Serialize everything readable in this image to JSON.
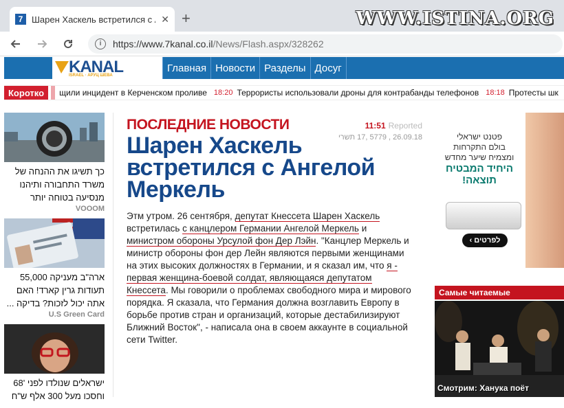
{
  "browser": {
    "tab_icon": "7",
    "tab_title": "Шарен Хаскель встретился с Анге",
    "tab_close": "✕",
    "new_tab": "+",
    "watermark": "WWW.ISTINA.ORG",
    "url_main": "https://www.7kanal.co.il",
    "url_path": "/News/Flash.aspx/328262"
  },
  "site": {
    "logo": "KANAL",
    "logo_sub": "ISRAEL · АРУЦ ШЕВА",
    "menu": [
      "Главная",
      "Новости",
      "Разделы",
      "Досуг"
    ]
  },
  "ticker": {
    "label": "Коротко",
    "items": [
      {
        "time": "",
        "text": "щили инцидент в Керченском проливе"
      },
      {
        "time": "18:20",
        "text": "Террористы использовали дроны для контрабанды телефонов"
      },
      {
        "time": "18:18",
        "text": "Протесты шк"
      }
    ]
  },
  "left": [
    {
      "text": "כך תשיגו את ההנחה של משרד התחבורה ותיהנו מנסיעה בטוחה יותר",
      "source": "VOOOM"
    },
    {
      "text": "ארה\"ב מעניקה 55,000 תעודות גרין קארד! האם אתה יכול לזכות? בדיקה ...",
      "source": "U.S Green Card"
    },
    {
      "text": "ישראלים שנולדו לפני '68 וחסכו מעל 300 אלף ש\"ח",
      "source": ""
    }
  ],
  "article": {
    "section": "ПОСЛЕДНИЕ НОВОСТИ",
    "time": "11:51",
    "reported": "Reported",
    "date": "26.09.18 , 5779 ,17 תשרי",
    "headline": "Шарен Хаскель встретился с Ангелой Меркель",
    "p1": "Этм утром. 26 сентября, ",
    "p1_hl": "депутат Кнессета Шарен Хаскель",
    "p2": " встретилась ",
    "p2_hl": "с канцлером Германии Ангелой Меркель",
    "p3": " и ",
    "p3_hl": "министром обороны Урсулой фон Дер Лэйн",
    "p4": ". \"Канцлер Меркель и министр обороны фон дер Лейн являются первыми женщинами на этих высоких должностях в Германии, и я сказал им, что ",
    "p4_hl": "я - первая женщина-боевой солдат, являющаяся депутатом Кнессета",
    "p5": ". Мы говорили о проблемах свободного мира и мирового порядка. Я сказала, что Германия должна возглавить Европу в борьбе против стран и организаций, которые дестабилизируют Ближний Восток\", - написала она в своем аккаунте в социальной сети Twitter."
  },
  "ad": {
    "line1": "פטנט ישראלי",
    "line2": "בולם התקרחות",
    "line3": "ומצמיח שיער מחדש",
    "line4": "היחיד המבטיח",
    "line5": "תוצאה!",
    "button": "לפרטים ›",
    "corner": "ף"
  },
  "most_read": {
    "title": "Самые читаемые",
    "caption": "Смотрим: Ханука поёт"
  }
}
